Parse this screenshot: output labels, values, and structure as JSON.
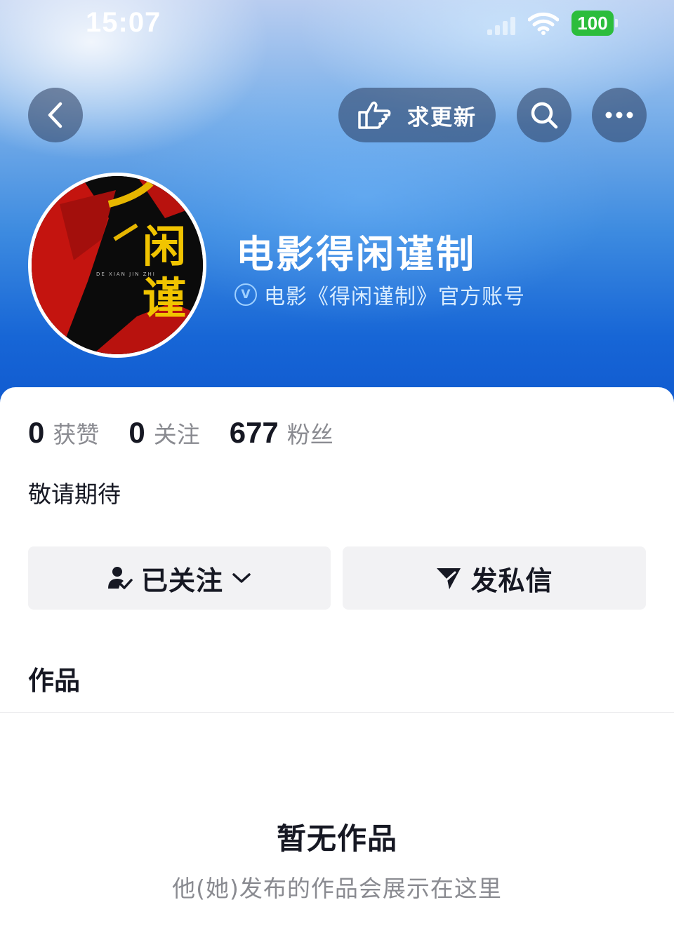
{
  "status_bar": {
    "time": "15:07",
    "battery": "100"
  },
  "top_bar": {
    "request_update_label": "求更新"
  },
  "profile": {
    "name": "电影得闲谨制",
    "verification": "电影《得闲谨制》官方账号",
    "avatar_text": "闲谨",
    "avatar_subtext": "DE XIAN JIN ZHI"
  },
  "stats": [
    {
      "value": "0",
      "label": "获赞"
    },
    {
      "value": "0",
      "label": "关注"
    },
    {
      "value": "677",
      "label": "粉丝"
    }
  ],
  "bio": "敬请期待",
  "actions": {
    "followed_label": "已关注",
    "message_label": "发私信"
  },
  "tabs": {
    "works_label": "作品"
  },
  "empty_state": {
    "title": "暂无作品",
    "subtitle": "他(她)发布的作品会展示在这里"
  },
  "colors": {
    "brand_blue": "#1766d6",
    "battery_green": "#2cbd3c",
    "secondary_text": "#8a8b91"
  }
}
